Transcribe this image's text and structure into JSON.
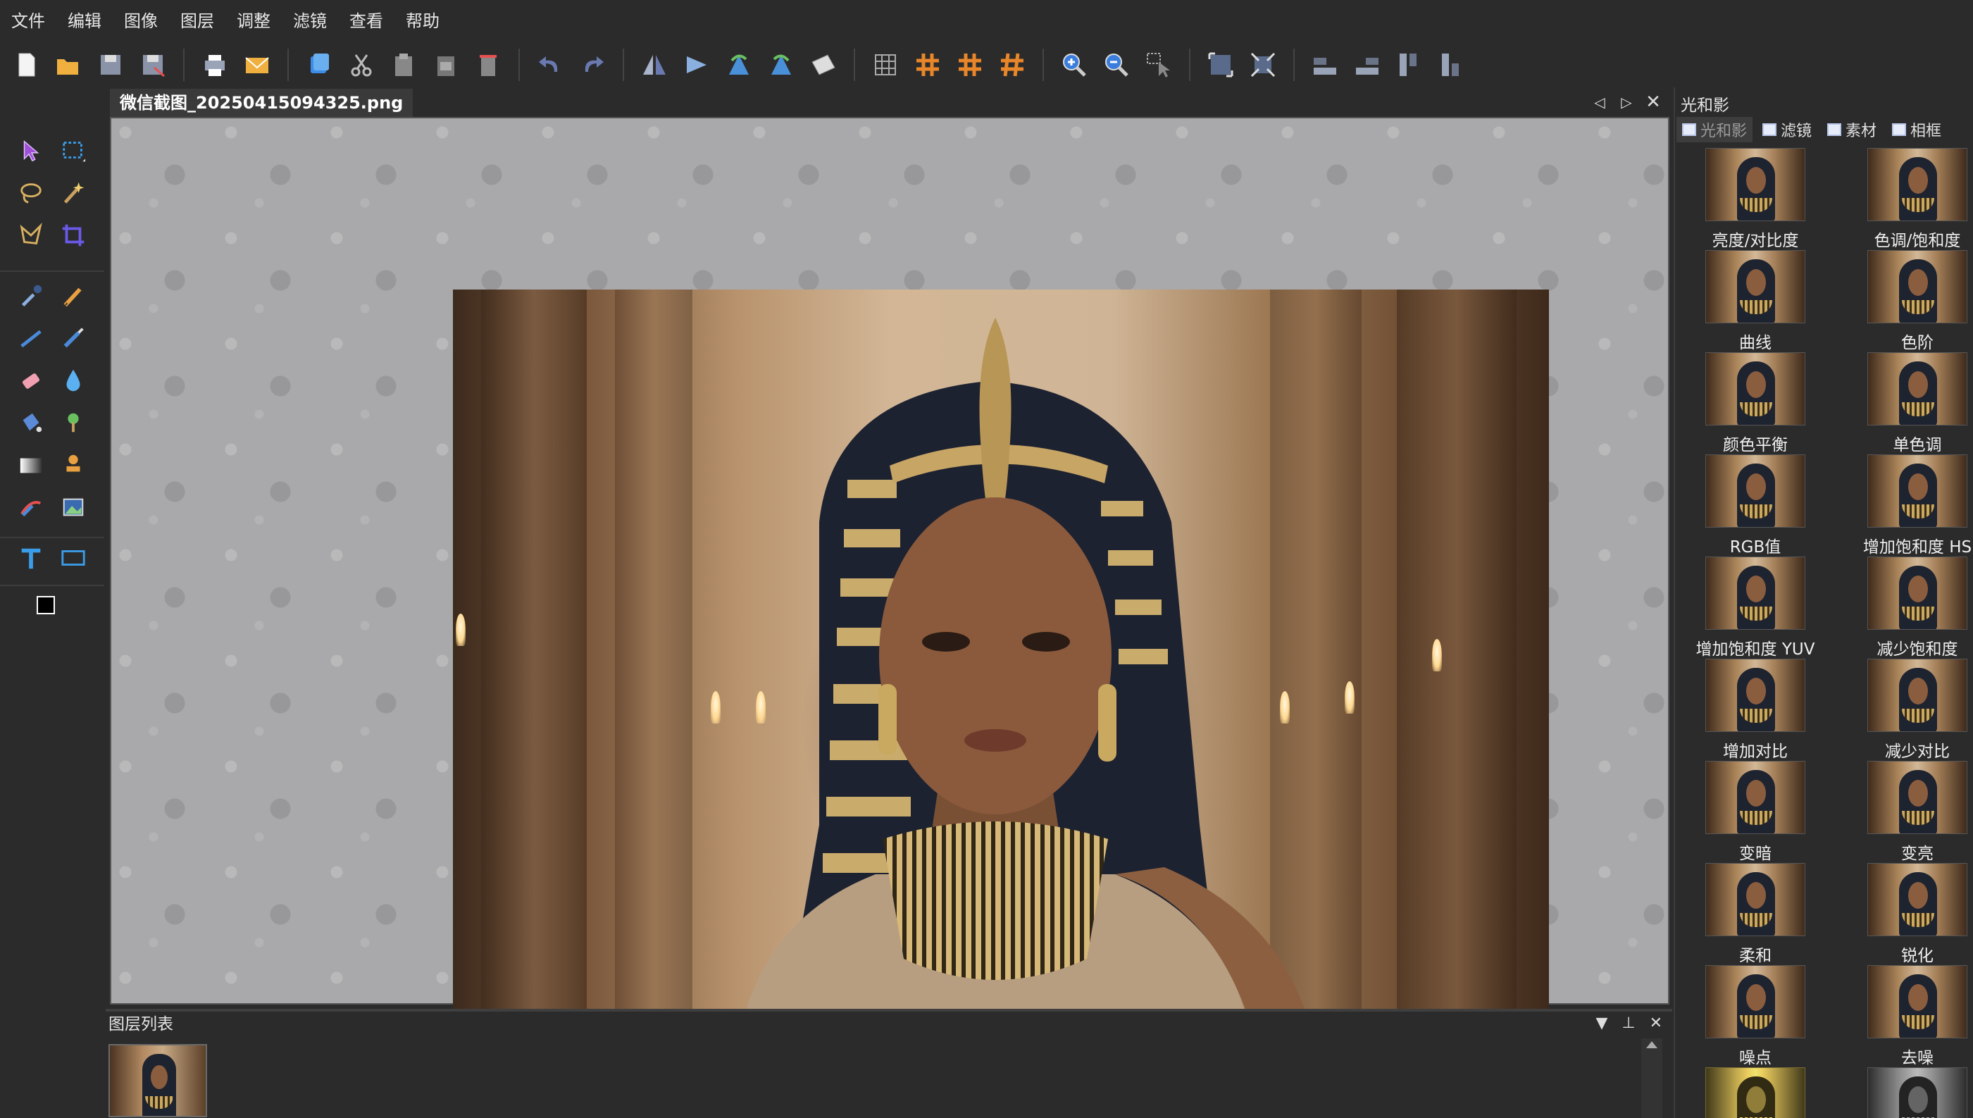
{
  "menu": [
    "文件",
    "编辑",
    "图像",
    "图层",
    "调整",
    "滤镜",
    "查看",
    "帮助"
  ],
  "toolbar": {
    "groups": [
      [
        "new-icon",
        "open-icon",
        "save-icon",
        "save-as-icon"
      ],
      [
        "print-icon",
        "email-icon"
      ],
      [
        "copy-icon",
        "cut-icon",
        "paste-icon",
        "paste-new-icon",
        "delete-icon"
      ],
      [
        "undo-icon",
        "redo-icon"
      ],
      [
        "flip-horizontal-icon",
        "flip-vertical-icon",
        "rotate-left-icon",
        "rotate-right-icon",
        "rotate-free-icon"
      ],
      [
        "grid-icon",
        "grid-hash-icon",
        "grid-hash2-icon",
        "grid-hash3-icon"
      ],
      [
        "zoom-in-icon",
        "zoom-out-icon",
        "select-pointer-icon"
      ],
      [
        "fit-window-icon",
        "actual-size-icon"
      ],
      [
        "align-left-icon",
        "align-right-icon",
        "align-top-icon",
        "align-bottom-icon"
      ]
    ]
  },
  "document": {
    "tab_title": "微信截图_20250415094325.png"
  },
  "layers": {
    "title": "图层列表"
  },
  "effects": {
    "panel_title": "光和影",
    "tabs": [
      "光和影",
      "滤镜",
      "素材",
      "相框"
    ],
    "items": [
      {
        "label": "亮度/对比度",
        "tone": "normal"
      },
      {
        "label": "色调/饱和度",
        "tone": "normal"
      },
      {
        "label": "曲线",
        "tone": "normal"
      },
      {
        "label": "色阶",
        "tone": "normal"
      },
      {
        "label": "颜色平衡",
        "tone": "normal"
      },
      {
        "label": "单色调",
        "tone": "normal"
      },
      {
        "label": "RGB值",
        "tone": "normal"
      },
      {
        "label": "增加饱和度 HS",
        "tone": "normal"
      },
      {
        "label": "增加饱和度 YUV",
        "tone": "normal"
      },
      {
        "label": "减少饱和度",
        "tone": "normal"
      },
      {
        "label": "增加对比",
        "tone": "normal"
      },
      {
        "label": "减少对比",
        "tone": "normal"
      },
      {
        "label": "变暗",
        "tone": "normal"
      },
      {
        "label": "变亮",
        "tone": "normal"
      },
      {
        "label": "柔和",
        "tone": "normal"
      },
      {
        "label": "锐化",
        "tone": "normal"
      },
      {
        "label": "噪点",
        "tone": "normal"
      },
      {
        "label": "去噪",
        "tone": "normal"
      },
      {
        "label": "",
        "tone": "yellow"
      },
      {
        "label": "",
        "tone": "gray"
      }
    ]
  },
  "colors": {
    "foreground": "#000000",
    "background": "#ffffff",
    "accent_blue": "#3b7ddd",
    "accent_orange": "#e8862a"
  }
}
